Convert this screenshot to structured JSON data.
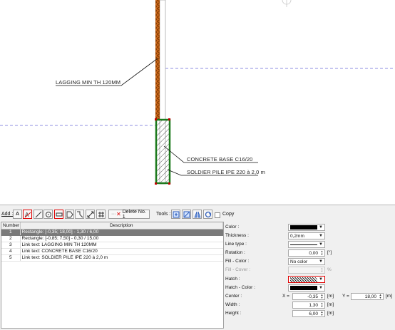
{
  "drawing": {
    "labels": {
      "lagging": "LAGGING MIN TH 120MM",
      "concrete": "CONCRETE BASE C16/20",
      "soldier": "SOLDIER PILE IPE 220 à 2,0 m"
    },
    "colors": {
      "lagging": "#c8661a",
      "concrete_outline": "#1d7a1d",
      "dashed_line": "#6a6ad8"
    }
  },
  "toolbar": {
    "add_label": "Add :",
    "add_buttons": [
      {
        "name": "text-tool-button",
        "glyph": "A"
      },
      {
        "name": "link-text-tool-button",
        "glyph": "link-text-icon"
      },
      {
        "name": "line-tool-button",
        "glyph": "line-icon"
      },
      {
        "name": "circle-tool-button",
        "glyph": "circle-icon"
      },
      {
        "name": "rectangle-tool-button",
        "glyph": "rectangle-icon"
      },
      {
        "name": "polygon-tool-button",
        "glyph": "polygon-icon"
      },
      {
        "name": "polyline-tool-button",
        "glyph": "polyline-icon"
      },
      {
        "name": "dimension-tool-button",
        "glyph": "dimension-icon"
      },
      {
        "name": "grid-tool-button",
        "glyph": "grid-icon"
      }
    ],
    "delete_label": "Delete No. 1",
    "tools_label": "Tools :",
    "copy_label": "Copy"
  },
  "table": {
    "headers": [
      "Number",
      "Description"
    ],
    "rows": [
      {
        "number": "1",
        "description": "Rectangle: [-0,35; 18,00] - 1,30 / 6,00",
        "selected": true
      },
      {
        "number": "2",
        "description": "Rectangle: [-0,85; 7,50] - 0,30 / 15,00",
        "selected": false
      },
      {
        "number": "3",
        "description": "Link text: LAGGING MIN TH 120MM",
        "selected": false
      },
      {
        "number": "4",
        "description": "Link text: CONCRETE BASE C16/20",
        "selected": false
      },
      {
        "number": "5",
        "description": "Link text: SOLDIER PILE IPE 220 à 2,0 m",
        "selected": false
      }
    ]
  },
  "properties": {
    "color_label": "Color :",
    "color_value": "#000000",
    "thickness_label": "Thickness :",
    "thickness_value": "0,2mm",
    "line_type_label": "Line type :",
    "rotation_label": "Rotation :",
    "rotation_value": "0,00",
    "rotation_unit": "[°]",
    "fill_color_label": "Fill - Color :",
    "fill_color_value": "No color",
    "fill_cover_label": "Fill - Cover :",
    "fill_cover_unit": "%",
    "hatch_label": "Hatch :",
    "hatch_color_label": "Hatch - Color :",
    "hatch_color_value": "#000000",
    "center_label": "Center :",
    "center_x_label": "X =",
    "center_x_value": "-0,35",
    "center_y_label": "Y =",
    "center_y_value": "18,00",
    "unit_m": "[m]",
    "width_label": "Width :",
    "width_value": "1,30",
    "height_label": "Height :",
    "height_value": "6,00"
  }
}
